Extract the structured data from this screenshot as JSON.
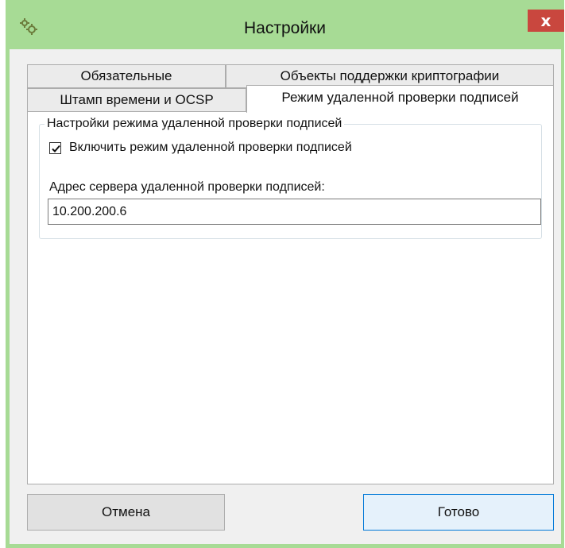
{
  "window": {
    "title": "Настройки",
    "close_label": "x",
    "icon": "gears-icon"
  },
  "tabs": [
    {
      "label": "Обязательные",
      "selected": false
    },
    {
      "label": "Объекты поддержки криптографии",
      "selected": false
    },
    {
      "label": "Штамп времени и OCSP",
      "selected": false
    },
    {
      "label": "Режим удаленной проверки подписей",
      "selected": true
    }
  ],
  "panel": {
    "group_title": "Настройки режима удаленной проверки подписей",
    "checkbox_label": "Включить режим удаленной проверки подписей",
    "checkbox_checked": true,
    "address_label": "Адрес сервера удаленной проверки подписей:",
    "address_value": "10.200.200.6"
  },
  "buttons": {
    "cancel": "Отмена",
    "done": "Готово"
  },
  "colors": {
    "frame": "#a7db95",
    "close": "#c9473e",
    "default_button_border": "#0078d7"
  }
}
